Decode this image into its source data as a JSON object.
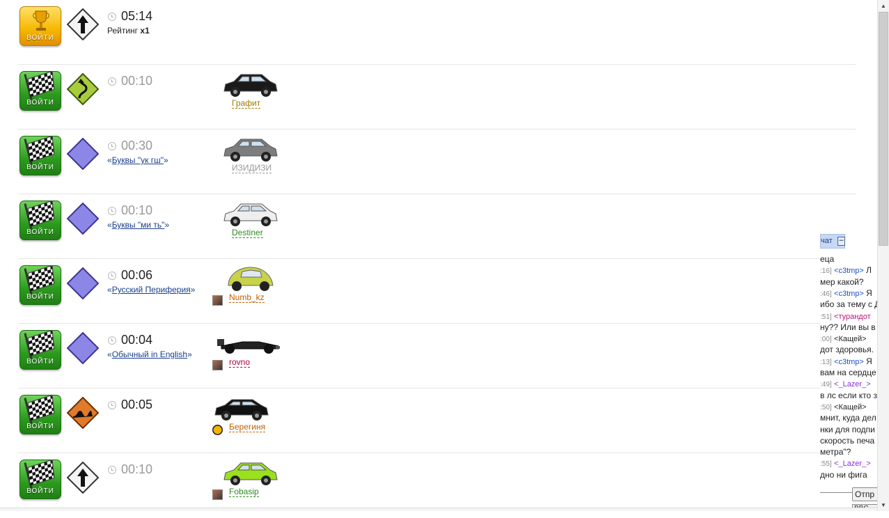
{
  "rows": [
    {
      "button": "ВОЙТИ",
      "button_style": "gold",
      "sign": "arrow-up-sign-icon",
      "time": "05:14",
      "time_active": true,
      "rating_prefix": "Рейтинг ",
      "rating_value": "x1"
    },
    {
      "button": "ВОЙТИ",
      "sign": "curvy-road-sign-icon",
      "time": "00:10",
      "time_active": false,
      "car": "black-hatchback-icon",
      "driver": "Графит",
      "driver_color": "#a37a00"
    },
    {
      "button": "ВОЙТИ",
      "sign": "purple-diamond-sign-icon",
      "time": "00:30",
      "time_active": false,
      "mode_open": "«",
      "mode": "Буквы \"ук гш\"",
      "mode_close": "»",
      "car": "gray-sedan-icon",
      "driver": "ИЗИДИЗИ",
      "driver_color": "#999999"
    },
    {
      "button": "ВОЙТИ",
      "sign": "purple-diamond-sign-icon",
      "time": "00:10",
      "time_active": false,
      "mode_open": "«",
      "mode": "Буквы \"ми ть\"",
      "mode_close": "»",
      "car": "white-minivan-icon",
      "driver": "Destiner",
      "driver_color": "#2e8b1f"
    },
    {
      "button": "ВОЙТИ",
      "sign": "purple-diamond-sign-icon",
      "time": "00:06",
      "time_active": true,
      "mode_open": "«",
      "mode": "Русский Периферия",
      "mode_close": "»",
      "car": "yellow-beetle-icon",
      "driver": "Numb_kz",
      "driver_color": "#c05f00",
      "avatar": "avatar-photo-icon"
    },
    {
      "button": "ВОЙТИ",
      "sign": "purple-diamond-sign-icon",
      "time": "00:04",
      "time_active": true,
      "mode_open": "«",
      "mode": "Обычный in English",
      "mode_close": "»",
      "car": "formula-car-icon",
      "driver": "rovno",
      "driver_color": "#b0003a",
      "avatar": "avatar-photo-icon"
    },
    {
      "button": "ВОЙТИ",
      "sign": "bump-sign-icon",
      "time": "00:05",
      "time_active": true,
      "car": "black-suv-icon",
      "driver": "Берегиня",
      "driver_color": "#c05f00",
      "avatar": "avatar-badge-icon"
    },
    {
      "button": "ВОЙТИ",
      "sign": "arrow-up-sign-icon",
      "time": "00:10",
      "time_active": false,
      "car": "lime-hatchback-icon",
      "driver": "Fobasip",
      "driver_color": "#2e8b1f",
      "avatar": "avatar-photo-icon"
    }
  ],
  "chat": {
    "header": "чат",
    "minimize": "–",
    "lines": [
      {
        "text": "еца",
        "color": "#222"
      },
      {
        "ts": ":16]",
        "nick": "<c3tmp>",
        "nick_color": "#1e50c8",
        "text": " Л"
      },
      {
        "text": "мер какой?"
      },
      {
        "ts": ":46]",
        "nick": "<c3tmp>",
        "nick_color": "#1e50c8",
        "text": " Я"
      },
      {
        "text": "ибо за тему с Д"
      },
      {
        "ts": ":51]",
        "nick": "<турандот",
        "nick_color": "#c0107a",
        "text": ""
      },
      {
        "text": "ну?? Или вы в"
      },
      {
        "ts": ":00]",
        "nick": "<Кащей>",
        "nick_color": "#222",
        "text": ""
      },
      {
        "text": "дот здоровья."
      },
      {
        "ts": ":13]",
        "nick": "<c3tmp>",
        "nick_color": "#1e50c8",
        "text": " Я"
      },
      {
        "text": "вам на сердце"
      },
      {
        "ts": ":49]",
        "nick": "<_Lazer_>",
        "nick_color": "#8a2be2",
        "text": ""
      },
      {
        "text": "в лс если кто з"
      },
      {
        "ts": ":50]",
        "nick": "<Кащей>",
        "nick_color": "#222",
        "text": ""
      },
      {
        "text": "мнит, куда дел"
      },
      {
        "text": "нки для подпи"
      },
      {
        "text": "скорость печа"
      },
      {
        "text": "метра\"?"
      },
      {
        "ts": ":55]",
        "nick": "<_Lazer_>",
        "nick_color": "#8a2be2",
        "text": ""
      },
      {
        "text": "дно ни фига"
      }
    ],
    "send_label": "Отпр",
    "bbcode_label": "BBC"
  },
  "scrollbar": {
    "up": "▲",
    "down": "▼"
  }
}
